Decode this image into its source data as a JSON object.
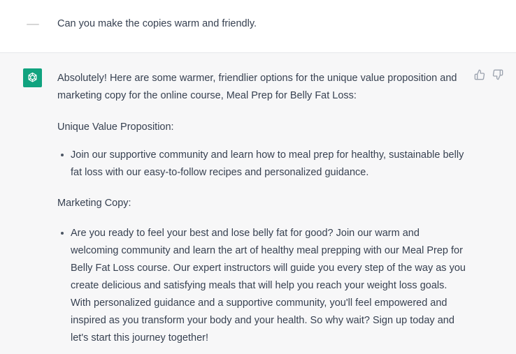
{
  "user_message": {
    "text": "Can you make the copies warm and friendly."
  },
  "assistant_message": {
    "intro": "Absolutely! Here are some warmer, friendlier options for the unique value proposition and marketing copy for the online course, Meal Prep for Belly Fat Loss:",
    "section1_label": "Unique Value Proposition:",
    "section1_bullet": "Join our supportive community and learn how to meal prep for healthy, sustainable belly fat loss with our easy-to-follow recipes and personalized guidance.",
    "section2_label": "Marketing Copy:",
    "section2_bullet": "Are you ready to feel your best and lose belly fat for good? Join our warm and welcoming community and learn the art of healthy meal prepping with our Meal Prep for Belly Fat Loss course. Our expert instructors will guide you every step of the way as you create delicious and satisfying meals that will help you reach your weight loss goals. With personalized guidance and a supportive community, you'll feel empowered and inspired as you transform your body and your health. So why wait? Sign up today and let's start this journey together!"
  },
  "icons": {
    "assistant_avatar": "openai-logo-icon",
    "thumbs_up": "thumbs-up-icon",
    "thumbs_down": "thumbs-down-icon"
  },
  "colors": {
    "assistant_bg": "#f7f7f8",
    "avatar_green": "#10a37f",
    "text": "#374151"
  }
}
